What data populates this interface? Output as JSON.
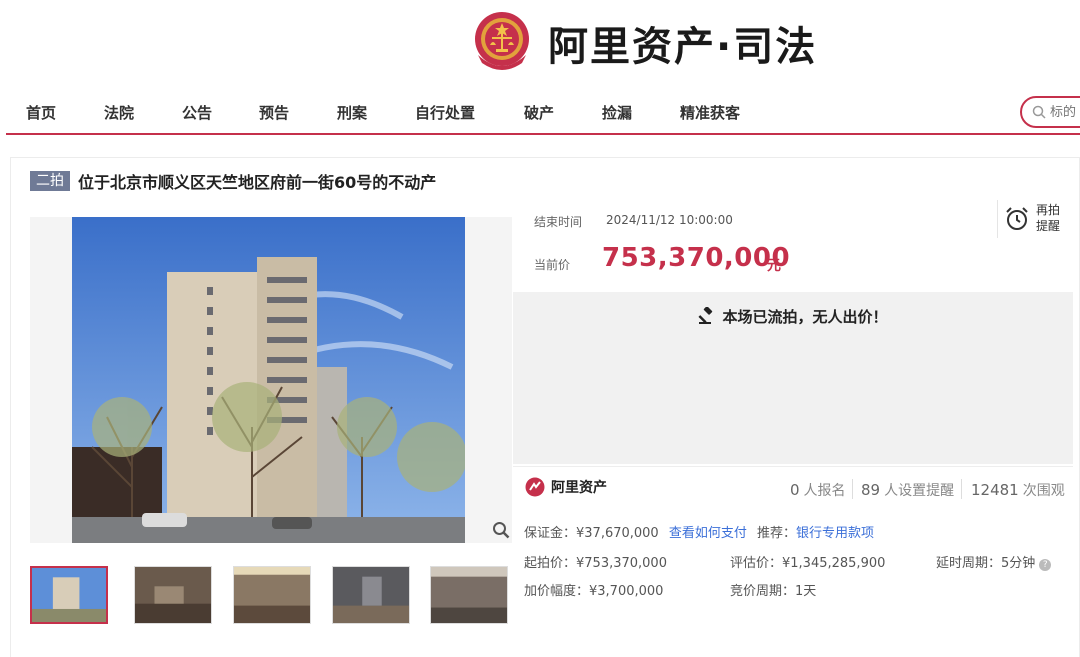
{
  "brand": {
    "title": "阿里资产·司法",
    "emblem_icon": "court-emblem-icon",
    "color": "#c5304b"
  },
  "nav": {
    "items": [
      "首页",
      "法院",
      "公告",
      "预告",
      "刑案",
      "自行处置",
      "破产",
      "捡漏",
      "精准获客"
    ],
    "search_placeholder": "标的"
  },
  "item": {
    "round_badge": "二拍",
    "title": "位于北京市顺义区天竺地区府前一街60号的不动产"
  },
  "auction": {
    "end_time_label": "结束时间",
    "end_time": "2024/11/12 10:00:00",
    "current_price_label": "当前价",
    "current_price": "753,370,000",
    "price_unit": "元",
    "remind_label_line1": "再拍",
    "remind_label_line2": "提醒",
    "status_message": "本场已流拍，无人出价！"
  },
  "stats": {
    "logo_text": "阿里资产",
    "registrations": "0",
    "registrations_label": "人报名",
    "reminders": "89",
    "reminders_label": "人设置提醒",
    "views": "12481",
    "views_label": "次围观"
  },
  "details": {
    "deposit": "保证金：¥37,670,000",
    "how_to_pay": "查看如何支付",
    "recommend_label": "推荐：",
    "recommend_link": "银行专用款项",
    "start_price": "起拍价：¥753,370,000",
    "appraisal": "评估价：¥1,345,285,900",
    "delay_period": "延时周期：5分钟",
    "increment": "加价幅度：¥3,700,000",
    "bid_period": "竞价周期：1天"
  }
}
